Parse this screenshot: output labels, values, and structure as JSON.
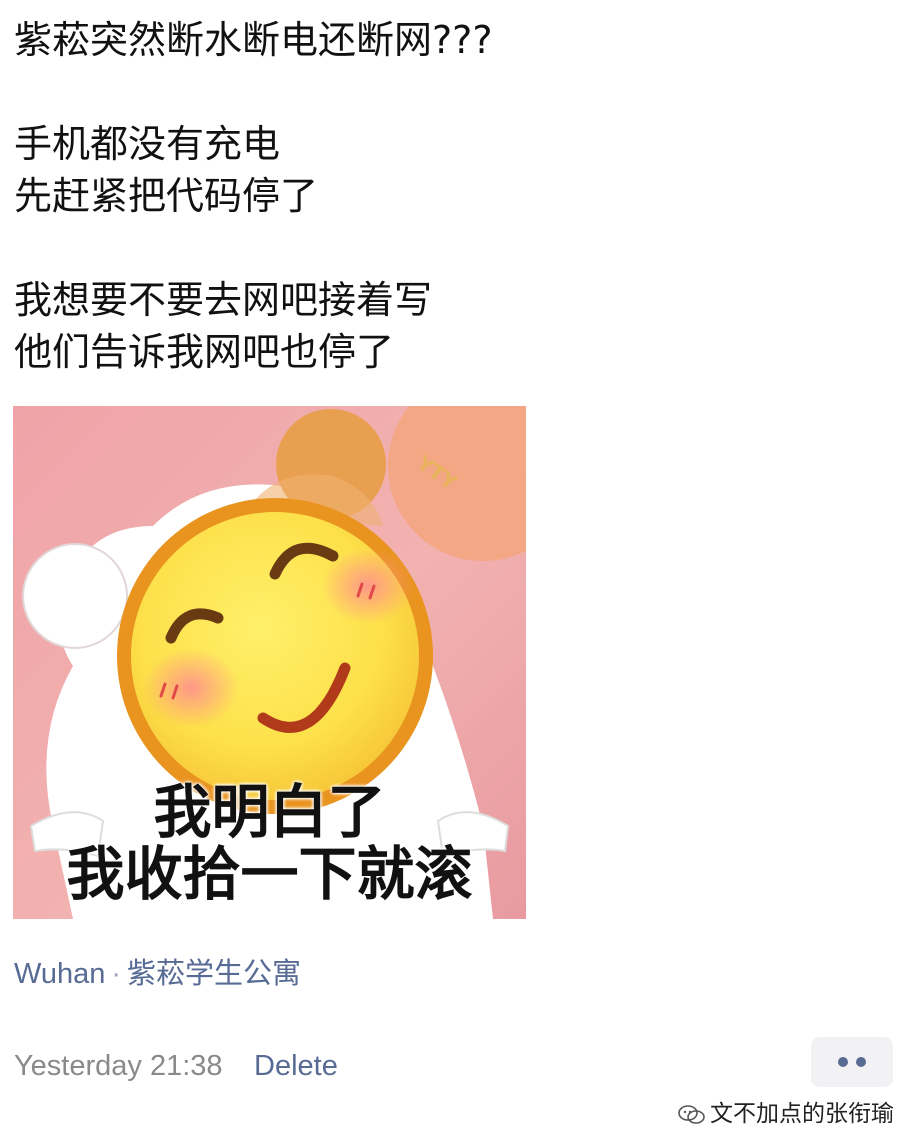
{
  "post": {
    "lines": [
      "紫菘突然断水断电还断网???",
      "",
      "手机都没有充电",
      "先赶紧把代码停了",
      "",
      "我想要不要去网吧接着写",
      "他们告诉我网吧也停了"
    ]
  },
  "meme": {
    "caption_line1": "我明白了",
    "caption_line2": "我收拾一下就滚",
    "watermark_text": "YTY",
    "colors": {
      "background": "#f0a8ab",
      "face": "#fde04a",
      "face_rim": "#e9941f",
      "hood": "#ffffff",
      "ear": "#e8a050"
    }
  },
  "location": {
    "city": "Wuhan",
    "separator": "·",
    "place": "紫菘学生公寓"
  },
  "footer": {
    "time": "Yesterday 21:38",
    "delete_label": "Delete",
    "more_icon": "more-dots-icon"
  },
  "watermark": {
    "icon": "wechat-icon",
    "text": "文不加点的张衔瑜"
  },
  "colors": {
    "link": "#576b95",
    "timestamp": "#8a8a8a",
    "text": "#111111"
  }
}
